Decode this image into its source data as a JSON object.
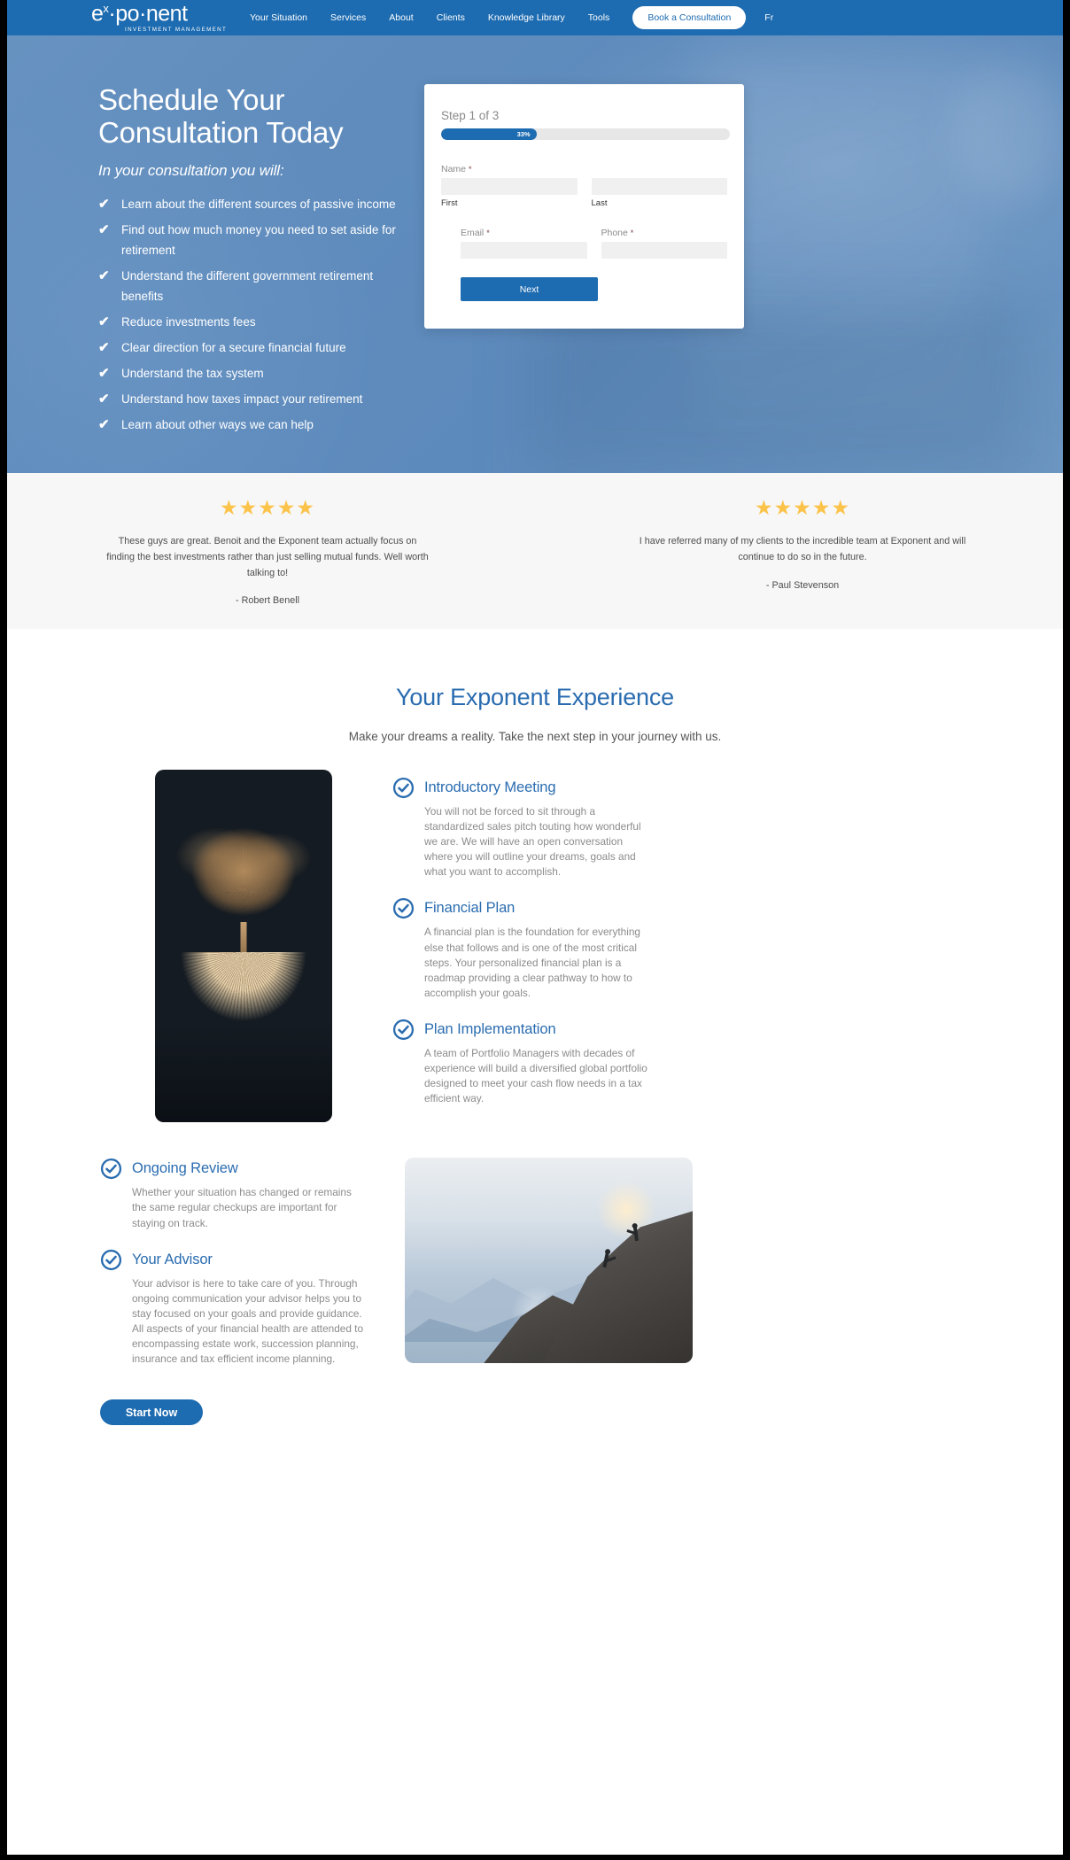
{
  "brand": {
    "logo_main_prefix": "e",
    "logo_main_sup": "x",
    "logo_main_rest": "·po·nent",
    "logo_sub": "INVESTMENT MANAGEMENT",
    "primary_color": "#1d6bb0",
    "accent_blue": "#2a6cb0",
    "star_color": "#fbc34a"
  },
  "nav": {
    "links": [
      {
        "label": "Your Situation"
      },
      {
        "label": "Services"
      },
      {
        "label": "About"
      },
      {
        "label": "Clients"
      },
      {
        "label": "Knowledge Library"
      },
      {
        "label": "Tools"
      }
    ],
    "cta_label": "Book a Consultation",
    "lang_label": "Fr"
  },
  "hero": {
    "title_line1": "Schedule Your",
    "title_line2": "Consultation Today",
    "subtitle": "In your consultation you will:",
    "check_glyph": "✔",
    "bullets": [
      "Learn about the different sources of passive income",
      "Find out how much money you need to set aside for retirement",
      "Understand the different government retirement benefits",
      "Reduce investments fees",
      "Clear direction for a secure financial future",
      "Understand the tax system",
      "Understand how taxes impact your retirement",
      "Learn about other ways we can help"
    ]
  },
  "form": {
    "step_label": "Step 1 of 3",
    "progress_percent": "33%",
    "progress_value": 33,
    "name_label": "Name",
    "required_mark": "*",
    "first_sublabel": "First",
    "last_sublabel": "Last",
    "first_value": "",
    "last_value": "",
    "email_label": "Email",
    "email_value": "",
    "phone_label": "Phone",
    "phone_value": "",
    "next_label": "Next"
  },
  "testimonials": {
    "stars_glyph": "★★★★★",
    "items": [
      {
        "quote": "These guys are great. Benoit and the Exponent team actually focus on finding the best investments rather than just selling mutual funds. Well worth talking to!",
        "author": "- Robert Benell"
      },
      {
        "quote": "I have referred many of my clients to the incredible team at Exponent and will continue to do so in the future.",
        "author": "- Paul Stevenson"
      }
    ]
  },
  "experience": {
    "title": "Your Exponent Experience",
    "subtitle": "Make your dreams a reality. Take the next step in your journey with us.",
    "features_right": [
      {
        "title": "Introductory Meeting",
        "body": "You will not be forced to sit through a standardized sales pitch touting how wonderful we are. We will have an open conversation where you will outline your dreams, goals and what you want to accomplish."
      },
      {
        "title": "Financial Plan",
        "body": "A financial plan is the foundation for everything else that follows and is one of the most critical steps. Your personalized financial plan is a roadmap providing a clear pathway to how to accomplish your goals."
      },
      {
        "title": "Plan Implementation",
        "body": "A team of Portfolio Managers with decades of experience will build a diversified global portfolio designed to meet your cash flow needs in a tax efficient way."
      }
    ],
    "features_left": [
      {
        "title": "Ongoing Review",
        "body": "Whether your situation has changed or remains the same regular checkups are important for staying on track."
      },
      {
        "title": "Your Advisor",
        "body": "Your advisor is here to take care of you. Through ongoing communication your advisor helps you to stay focused on your goals and provide guidance. All aspects of your financial health are attended to encompassing estate work, succession planning, insurance and tax efficient income planning."
      }
    ],
    "start_label": "Start Now"
  }
}
